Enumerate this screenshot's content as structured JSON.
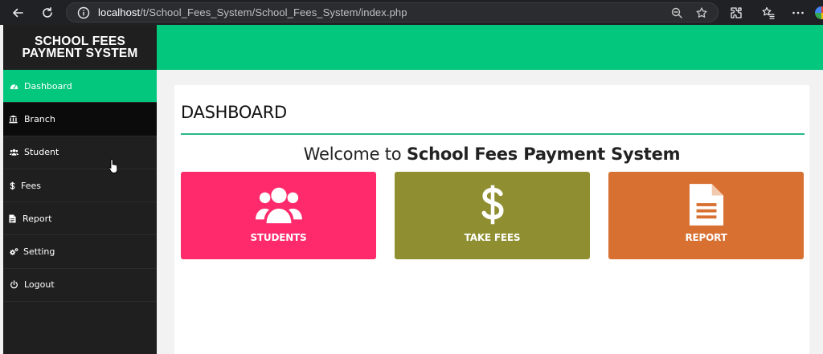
{
  "browser": {
    "url_host": "localhost",
    "url_path": "/t/School_Fees_System/School_Fees_System/index.php"
  },
  "sidebar": {
    "title_line1": "SCHOOL FEES",
    "title_line2": "PAYMENT SYSTEM",
    "items": [
      {
        "label": "Dashboard",
        "icon": "dashboard-icon"
      },
      {
        "label": "Branch",
        "icon": "bank-icon"
      },
      {
        "label": "Student",
        "icon": "users-icon"
      },
      {
        "label": "Fees",
        "icon": "dollar-icon"
      },
      {
        "label": "Report",
        "icon": "file-icon"
      },
      {
        "label": "Setting",
        "icon": "gears-icon"
      },
      {
        "label": "Logout",
        "icon": "power-icon"
      }
    ]
  },
  "main": {
    "page_title": "DASHBOARD",
    "welcome_prefix": "Welcome to ",
    "welcome_strong": "School Fees Payment System",
    "cards": [
      {
        "label": "STUDENTS",
        "icon": "users-icon",
        "color": "#fe2a6c"
      },
      {
        "label": "TAKE FEES",
        "icon": "dollar-icon",
        "color": "#8f8f31"
      },
      {
        "label": "REPORT",
        "icon": "file-text-icon",
        "color": "#d87031"
      }
    ]
  },
  "colors": {
    "accent": "#03c77d",
    "sidebar_bg": "#1f1f1f"
  }
}
